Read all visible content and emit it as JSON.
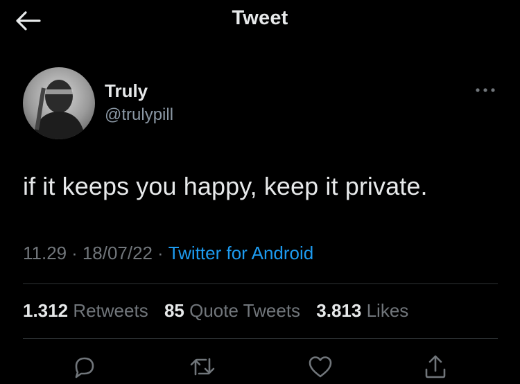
{
  "header": {
    "title": "Tweet",
    "back_icon": "arrow-left-icon"
  },
  "author": {
    "display_name": "Truly",
    "handle": "@trulypill",
    "avatar_icon": "avatar-photo",
    "more_icon": "more-horizontal-icon"
  },
  "tweet": {
    "text": "if it keeps you happy, keep it private."
  },
  "meta": {
    "time": "11.29",
    "date": "18/07/22",
    "source": "Twitter for Android",
    "separator": "·"
  },
  "stats": {
    "retweets_count": "1.312",
    "retweets_label": "Retweets",
    "quotes_count": "85",
    "quotes_label": "Quote Tweets",
    "likes_count": "3.813",
    "likes_label": "Likes"
  },
  "actions": [
    "reply-icon",
    "retweet-icon",
    "like-icon",
    "share-icon"
  ],
  "colors": {
    "background": "#000000",
    "text": "#e7e9ea",
    "muted": "#71767b",
    "accent": "#1d9bf0",
    "divider": "#2f3336"
  }
}
